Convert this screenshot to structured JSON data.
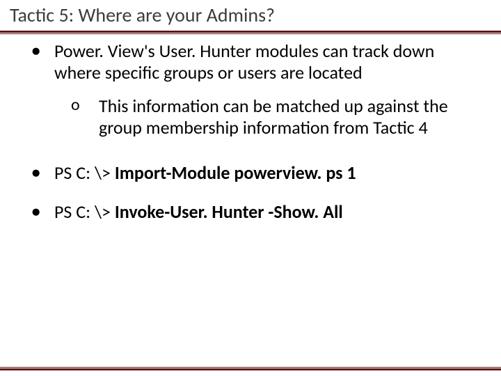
{
  "title": "Tactic 5: Where are your Admins?",
  "bullets": {
    "b1": "Power. View's User. Hunter modules can track down where specific groups or users are located",
    "b1_sub": "This information can be matched up against the group membership information from Tactic 4",
    "cmd1_prefix": "PS C: \\> ",
    "cmd1_bold": "Import-Module powerview. ps 1",
    "cmd2_prefix": "PS C: \\> ",
    "cmd2_bold": "Invoke-User. Hunter -Show. All"
  },
  "glyphs": {
    "disc": "●",
    "circ": "o"
  },
  "colors": {
    "rule": "#611415"
  }
}
